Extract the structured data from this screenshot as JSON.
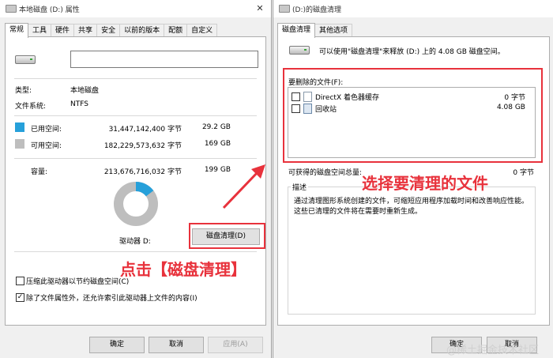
{
  "left": {
    "title": "本地磁盘 (D:) 属性",
    "close": "✕",
    "tabs": [
      "常规",
      "工具",
      "硬件",
      "共享",
      "安全",
      "以前的版本",
      "配额",
      "自定义"
    ],
    "name_value": "",
    "type_label": "类型:",
    "type_value": "本地磁盘",
    "fs_label": "文件系统:",
    "fs_value": "NTFS",
    "used_label": "已用空间:",
    "used_bytes": "31,447,142,400 字节",
    "used_size": "29.2 GB",
    "free_label": "可用空间:",
    "free_bytes": "182,229,573,632 字节",
    "free_size": "169 GB",
    "capacity_label": "容量:",
    "capacity_bytes": "213,676,716,032 字节",
    "capacity_size": "199 GB",
    "drive_label": "驱动器 D:",
    "cleanup_button": "磁盘清理(D)",
    "compress_label": "压缩此驱动器以节约磁盘空间(C)",
    "index_label": "除了文件属性外，还允许索引此驱动器上文件的内容(I)",
    "ok": "确定",
    "cancel": "取消",
    "apply": "应用(A)",
    "used_fraction": 0.147
  },
  "right": {
    "title": "(D:)的磁盘清理",
    "tabs": [
      "磁盘清理",
      "其他选项"
    ],
    "summary": "可以使用\"磁盘清理\"来释放  (D:) 上的 4.08 GB 磁盘空间。",
    "files_label": "要删除的文件(F):",
    "files": [
      {
        "name": "DirectX 着色器缓存",
        "size": "0 字节"
      },
      {
        "name": "回收站",
        "size": "4.08 GB"
      }
    ],
    "total_label": "可获得的磁盘空间总量:",
    "total_value": "0 字节",
    "desc_label": "描述",
    "desc_text": "通过清理图形系统创建的文件，可缩短应用程序加载时间和改善响应性能。这些已清理的文件将在需要时重新生成。",
    "ok": "确定",
    "cancel": "取消"
  },
  "annotations": {
    "click_text": "点击【磁盘清理】",
    "select_text": "选择要清理的文件"
  },
  "watermark": "@稀土掘金技术社区",
  "colors": {
    "used": "#26a0da",
    "free": "#bebebe",
    "annotation": "#e8323c"
  }
}
